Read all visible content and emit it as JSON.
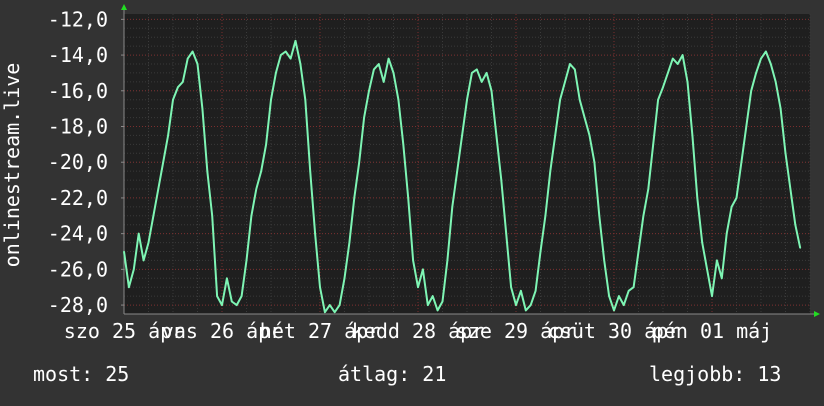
{
  "chart_data": {
    "type": "line",
    "ylabel": "onlinestream.live",
    "ylim": [
      -28.5,
      -11.7
    ],
    "y_ticks": [
      "-12,0",
      "-14,0",
      "-16,0",
      "-18,0",
      "-20,0",
      "-22,0",
      "-24,0",
      "-26,0",
      "-28,0"
    ],
    "y_tick_values": [
      -12,
      -14,
      -16,
      -18,
      -20,
      -22,
      -24,
      -26,
      -28
    ],
    "x_ticks": [
      "szo 25 ápr",
      "vas 26 ápr",
      "hét 27 ápr",
      "kedd 28 ápr",
      "sze 29 ápr",
      "csüt 30 ápr",
      "pén 01 máj"
    ],
    "x_tick_positions": [
      0,
      1,
      2,
      3,
      4,
      5,
      6
    ],
    "xlim": [
      0,
      7.0
    ],
    "grid": true,
    "series": [
      {
        "color": "#7ef5b4",
        "x": [
          0.0,
          0.05,
          0.1,
          0.15,
          0.2,
          0.25,
          0.3,
          0.35,
          0.4,
          0.45,
          0.5,
          0.55,
          0.6,
          0.65,
          0.7,
          0.75,
          0.8,
          0.85,
          0.9,
          0.95,
          1.0,
          1.05,
          1.1,
          1.15,
          1.2,
          1.25,
          1.3,
          1.35,
          1.4,
          1.45,
          1.5,
          1.55,
          1.6,
          1.65,
          1.7,
          1.75,
          1.8,
          1.85,
          1.9,
          1.95,
          2.0,
          2.05,
          2.1,
          2.15,
          2.2,
          2.25,
          2.3,
          2.35,
          2.4,
          2.45,
          2.5,
          2.55,
          2.6,
          2.65,
          2.7,
          2.75,
          2.8,
          2.85,
          2.9,
          2.95,
          3.0,
          3.05,
          3.1,
          3.15,
          3.2,
          3.25,
          3.3,
          3.35,
          3.4,
          3.45,
          3.5,
          3.55,
          3.6,
          3.65,
          3.7,
          3.75,
          3.8,
          3.85,
          3.9,
          3.95,
          4.0,
          4.05,
          4.1,
          4.15,
          4.2,
          4.25,
          4.3,
          4.35,
          4.4,
          4.45,
          4.5,
          4.55,
          4.6,
          4.65,
          4.7,
          4.75,
          4.8,
          4.85,
          4.9,
          4.95,
          5.0,
          5.05,
          5.1,
          5.15,
          5.2,
          5.25,
          5.3,
          5.35,
          5.4,
          5.45,
          5.5,
          5.55,
          5.6,
          5.65,
          5.7,
          5.75,
          5.8,
          5.85,
          5.9,
          5.95,
          6.0,
          6.05,
          6.1,
          6.15,
          6.2,
          6.25,
          6.3,
          6.35,
          6.4,
          6.45,
          6.5,
          6.55,
          6.6,
          6.65,
          6.7,
          6.75,
          6.8,
          6.85,
          6.9
        ],
        "y": [
          -25.0,
          -27.0,
          -26.0,
          -24.0,
          -25.5,
          -24.5,
          -23.0,
          -21.5,
          -20.0,
          -18.5,
          -16.5,
          -15.8,
          -15.5,
          -14.2,
          -13.8,
          -14.5,
          -17.0,
          -20.5,
          -23.0,
          -27.5,
          -28.0,
          -26.5,
          -27.8,
          -28.0,
          -27.5,
          -25.5,
          -23.0,
          -21.5,
          -20.5,
          -19.0,
          -16.5,
          -15.0,
          -14.0,
          -13.8,
          -14.2,
          -13.2,
          -14.5,
          -16.5,
          -20.5,
          -24.0,
          -27.0,
          -28.4,
          -28.0,
          -28.4,
          -28.0,
          -26.5,
          -24.5,
          -22.0,
          -20.0,
          -17.5,
          -16.0,
          -14.8,
          -14.5,
          -15.5,
          -14.2,
          -15.0,
          -16.5,
          -19.0,
          -22.0,
          -25.5,
          -27.0,
          -26.0,
          -28.0,
          -27.5,
          -28.3,
          -27.8,
          -25.5,
          -22.5,
          -20.5,
          -18.5,
          -16.5,
          -15.0,
          -14.8,
          -15.5,
          -15.0,
          -16.0,
          -18.5,
          -21.0,
          -24.0,
          -27.0,
          -28.0,
          -27.2,
          -28.3,
          -28.0,
          -27.2,
          -25.0,
          -23.0,
          -20.5,
          -18.5,
          -16.5,
          -15.5,
          -14.5,
          -14.8,
          -16.5,
          -17.5,
          -18.5,
          -20.0,
          -23.0,
          -25.5,
          -27.5,
          -28.3,
          -27.5,
          -28.0,
          -27.2,
          -27.0,
          -25.0,
          -23.0,
          -21.5,
          -19.0,
          -16.5,
          -15.8,
          -15.0,
          -14.2,
          -14.5,
          -14.0,
          -15.5,
          -18.5,
          -22.0,
          -24.5,
          -26.0,
          -27.5,
          -25.5,
          -26.5,
          -24.0,
          -22.5,
          -22.0,
          -20.0,
          -18.0,
          -16.0,
          -15.0,
          -14.2,
          -13.8,
          -14.5,
          -15.5,
          -17.0,
          -19.5,
          -21.5,
          -23.5,
          -24.8
        ]
      }
    ]
  },
  "stats": {
    "current": "most: 25",
    "average": "átlag: 21",
    "max": "legjobb: 13"
  },
  "colors": {
    "background": "#333333",
    "plot_background": "#1f1f1f",
    "grid_minor": "#3a3a3a",
    "grid_major": "#7a2e2e",
    "axis": "#8a8a8a",
    "arrow": "#22dd22",
    "text": "#ffffff"
  }
}
